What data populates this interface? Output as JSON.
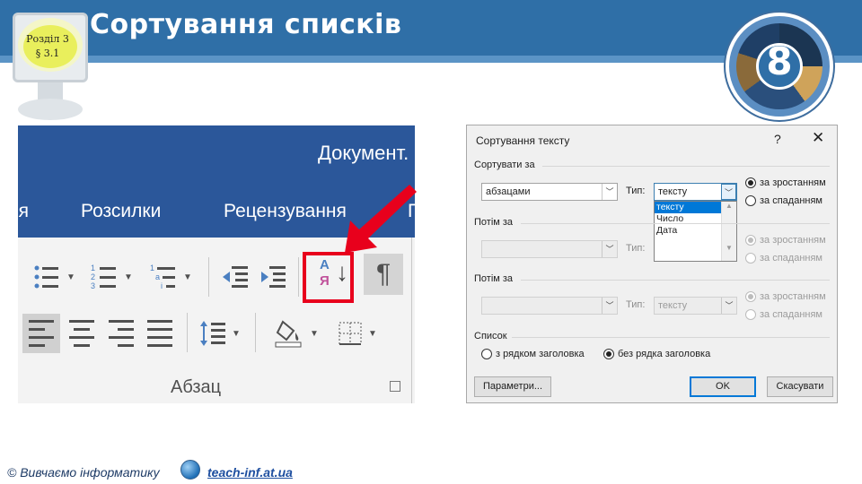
{
  "slide": {
    "title": "Сортування списків",
    "section_line1": "Розділ 3",
    "section_line2": "§ 3.1",
    "badge_number": "8",
    "footer_copyright": "© Вивчаємо інформатику",
    "footer_link": "teach-inf.at.ua"
  },
  "ribbon": {
    "document_title": "Документ.",
    "tabs": [
      "ія",
      "Розсилки",
      "Рецензування",
      "П"
    ],
    "group_label": "Абзац",
    "sort_icon_letters": [
      "А",
      "Я"
    ],
    "pilcrow": "¶",
    "icons": [
      "bullets-icon",
      "numbering-icon",
      "multilevel-list-icon",
      "decrease-indent-icon",
      "increase-indent-icon",
      "sort-icon",
      "show-marks-icon",
      "align-left-icon",
      "align-center-icon",
      "align-right-icon",
      "justify-icon",
      "line-spacing-icon",
      "shading-icon",
      "borders-icon"
    ]
  },
  "dialog": {
    "title": "Сортування тексту",
    "help": "?",
    "close": "✕",
    "sort_by_label": "Сортувати за",
    "sort_by_value": "абзацами",
    "type_label": "Тип:",
    "type_value": "тексту",
    "type_options": [
      "тексту",
      "Число",
      "Дата"
    ],
    "ascending": "за зростанням",
    "descending": "за спаданням",
    "then_by_label_1": "Потім за",
    "then_by_label_2": "Потім за",
    "type_value_3": "тексту",
    "list_label": "Список",
    "with_header": "з рядком заголовка",
    "without_header": "без рядка заголовка",
    "options_button": "Параметри...",
    "ok_button": "OK",
    "cancel_button": "Скасувати"
  },
  "colors": {
    "header_blue": "#2f6fa7",
    "ribbon_blue": "#2b579a",
    "highlight_red": "#e8001c",
    "selection_blue": "#0078d7"
  }
}
